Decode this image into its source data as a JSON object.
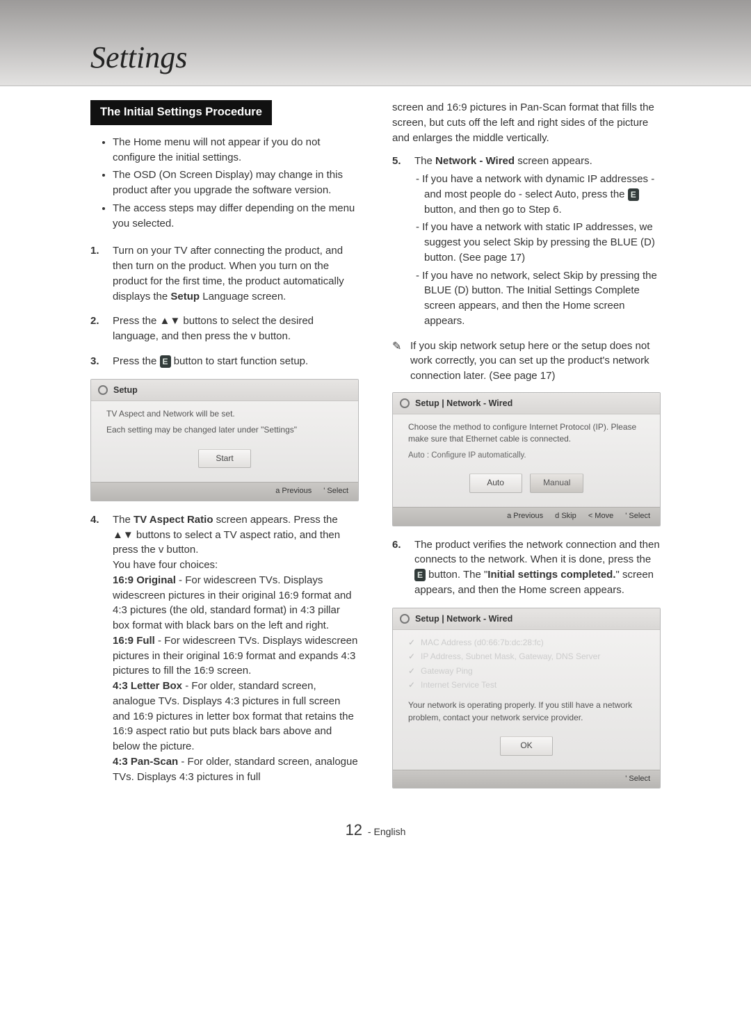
{
  "page": {
    "title": "Settings",
    "section_heading": "The Initial Settings Procedure",
    "page_number": "12",
    "page_lang": "English"
  },
  "bullets": [
    "The Home menu will not appear if you do not configure the initial settings.",
    "The OSD (On Screen Display) may change in this product after you upgrade the software version.",
    "The access steps may differ depending on the menu you selected."
  ],
  "step1_prefix": "Turn on your TV after connecting the product, and then turn on the product. When you turn on the product for the first time, the product automatically displays the ",
  "step1_bold": "Setup",
  "step1_suffix": " Language screen.",
  "step2": "Press the ▲▼ buttons to select the desired language, and then press the v button.",
  "step3_prefix": "Press the ",
  "step3_suffix": " button to start function setup.",
  "enter_glyph": "E",
  "osd_setup": {
    "title": "Setup",
    "line1": "TV Aspect and Network will be set.",
    "line2": "Each setting may be changed later under \"Settings\"",
    "start_btn": "Start",
    "footer_prev": "a Previous",
    "footer_select": "' Select"
  },
  "step4_prefix": "The ",
  "step4_bold": "TV Aspect Ratio",
  "step4_mid": " screen appears. Press the ▲▼ buttons to select a TV aspect ratio, and then press the v button.",
  "step4_choices_intro": "You have four choices:",
  "aspect_169_original_label": "16:9 Original",
  "aspect_169_original_text": " - For widescreen TVs. Displays widescreen pictures in their original 16:9 format and 4:3 pictures (the old, standard format) in 4:3 pillar box format with black bars on the left and right.",
  "aspect_169_full_label": "16:9 Full",
  "aspect_169_full_text": " - For widescreen TVs. Displays widescreen pictures in their original 16:9 format and expands 4:3 pictures to fill the 16:9 screen.",
  "aspect_43_letter_label": "4:3 Letter Box",
  "aspect_43_letter_text": " - For older, standard screen, analogue TVs. Displays 4:3 pictures in full screen and 16:9 pictures in letter box format that retains the 16:9 aspect ratio but puts black bars above and below the picture.",
  "aspect_43_pan_label": "4:3 Pan-Scan",
  "aspect_43_pan_text": " - For older, standard screen, analogue TVs. Displays 4:3 pictures in full",
  "col2_continued": "screen and 16:9 pictures in Pan-Scan format that fills the screen, but cuts off the left and right sides of the picture and enlarges the middle vertically.",
  "step5_prefix": "The ",
  "step5_bold": "Network - Wired",
  "step5_suffix": " screen appears.",
  "step5_dash1_before": "If you have a network with dynamic IP addresses - and most people do - select Auto, press the ",
  "step5_dash1_after": " button, and then go to Step 6.",
  "step5_dash2": "If you have a network with static IP addresses, we suggest you select Skip by pressing the BLUE (D) button. (See page 17)",
  "step5_dash3": "If you have no network, select Skip by pressing the BLUE (D) button. The Initial Settings Complete screen appears, and then the Home screen appears.",
  "note_text": "If you skip network setup here or the setup does not work correctly, you can set up the product's network connection later. (See page 17)",
  "note_icon": "✎",
  "osd_network1": {
    "title": "Setup | Network - Wired",
    "msg": "Choose the method to configure Internet Protocol (IP). Please make sure that Ethernet cable is connected.",
    "sub": "Auto : Configure IP automatically.",
    "btn_auto": "Auto",
    "btn_manual": "Manual",
    "footer": {
      "prev": "a Previous",
      "skip": "d Skip",
      "move": "< Move",
      "select": "' Select"
    }
  },
  "step6_before": "The product verifies the network connection and then connects to the network. When it is done, press the ",
  "step6_mid": " button. The \"",
  "step6_bold": "Initial settings completed.",
  "step6_after": "\" screen appears, and then the Home screen appears.",
  "osd_network2": {
    "title": "Setup | Network - Wired",
    "items": [
      "MAC Address (d0:66:7b:dc:28:fc)",
      "IP Address, Subnet Mask, Gateway, DNS Server",
      "Gateway Ping",
      "Internet Service Test"
    ],
    "msg": "Your network is operating properly. If you still have a network problem, contact your network service provider.",
    "ok": "OK",
    "footer_select": "' Select"
  }
}
